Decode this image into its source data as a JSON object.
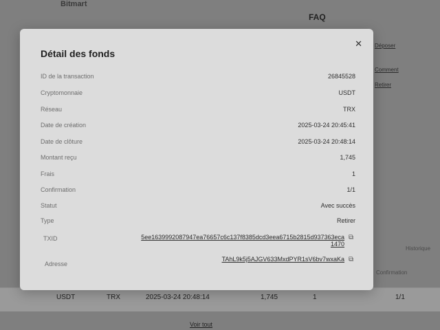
{
  "background": {
    "title": "Bitmart",
    "faq": "FAQ",
    "links": [
      "Déposer",
      "Comment",
      "Retirer",
      "Historique"
    ],
    "side_label": "Historique",
    "side_label2": "Confirmation",
    "table_row": {
      "crypto": "USDT",
      "network": "TRX",
      "date": "2025-03-24 20:48:14",
      "amount": "1,745",
      "fees": "1",
      "confirmation": "1/1"
    },
    "see_all": "Voir tout"
  },
  "modal": {
    "title": "Détail des fonds",
    "close_icon": "close-icon",
    "fields": [
      {
        "label": "ID de la transaction",
        "value": "26845528"
      },
      {
        "label": "Cryptomonnaie",
        "value": "USDT"
      },
      {
        "label": "Réseau",
        "value": "TRX"
      },
      {
        "label": "Date de création",
        "value": "2025-03-24 20:45:41"
      },
      {
        "label": "Date de clôture",
        "value": "2025-03-24 20:48:14"
      },
      {
        "label": "Montant reçu",
        "value": "1,745"
      },
      {
        "label": "Frais",
        "value": "1"
      },
      {
        "label": "Confirmation",
        "value": "1/1"
      },
      {
        "label": "Statut",
        "value": "Avec succès"
      },
      {
        "label": "Type",
        "value": "Retirer"
      }
    ],
    "txid_label": "TXID",
    "txid_value": "5ee1639992087947ea76657c6c137f8385dcd3eea6715b2815d937363eca1470",
    "address_label": "Adresse",
    "address_value": "TAhL9k5j5AJGV633MxdPYR1sV6bv7wxaKa",
    "copy_icon": "copy-icon"
  }
}
